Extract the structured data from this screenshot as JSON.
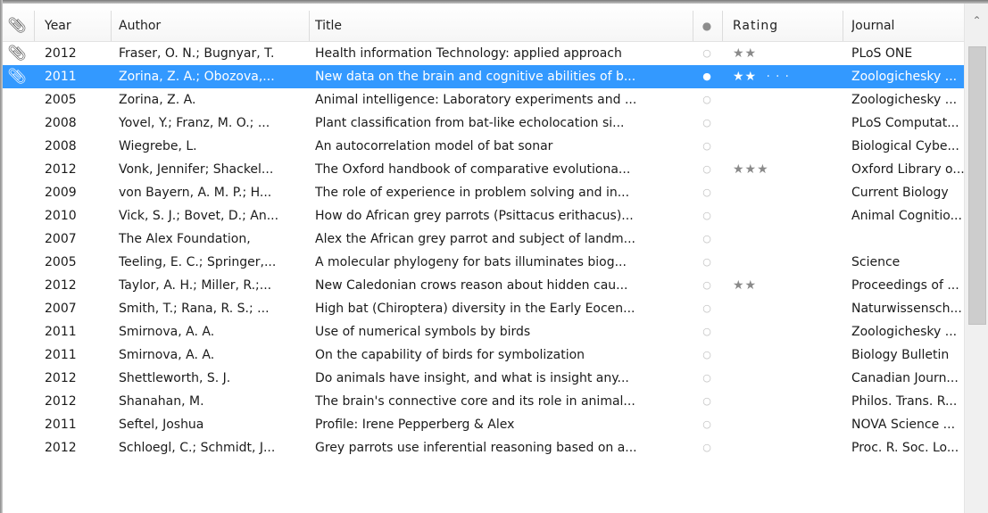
{
  "columns": {
    "attachments_icon": "paperclip-icon",
    "year": "Year",
    "author": "Author",
    "title": "Title",
    "read_icon": "read-status-icon",
    "rating": "Rating",
    "journal": "Journal"
  },
  "colors": {
    "selection": "#3399ff",
    "star": "#8a8a8a"
  },
  "rows": [
    {
      "attachment": true,
      "selected": false,
      "year": "2012",
      "author": "Fraser, O. N.; Bugnyar, T.",
      "title": "Health information Technology: applied approach",
      "read": "○",
      "rating": "★★",
      "journal": "PLoS ONE"
    },
    {
      "attachment": true,
      "selected": true,
      "year": "2011",
      "author": "Zorina, Z. A.; Obozova,...",
      "title": "New data on the brain and cognitive abilities of b...",
      "read": "●",
      "rating": "★★",
      "journal": "Zoologichesky ..."
    },
    {
      "attachment": false,
      "selected": false,
      "year": "2005",
      "author": "Zorina, Z. A.",
      "title": "Animal intelligence: Laboratory experiments and ...",
      "read": "○",
      "rating": "",
      "journal": "Zoologichesky ..."
    },
    {
      "attachment": false,
      "selected": false,
      "year": "2008",
      "author": "Yovel, Y.; Franz, M. O.; ...",
      "title": "Plant classification from bat-like echolocation si...",
      "read": "○",
      "rating": "",
      "journal": "PLoS Computat..."
    },
    {
      "attachment": false,
      "selected": false,
      "year": "2008",
      "author": "Wiegrebe, L.",
      "title": "An autocorrelation model of bat sonar",
      "read": "○",
      "rating": "",
      "journal": "Biological Cybe..."
    },
    {
      "attachment": false,
      "selected": false,
      "year": "2012",
      "author": "Vonk, Jennifer; Shackel...",
      "title": "The Oxford handbook of comparative evolutiona...",
      "read": "○",
      "rating": "★★★",
      "journal": "Oxford Library o..."
    },
    {
      "attachment": false,
      "selected": false,
      "year": "2009",
      "author": "von Bayern, A. M. P.; H...",
      "title": "The role of experience in problem solving and in...",
      "read": "○",
      "rating": "",
      "journal": "Current Biology"
    },
    {
      "attachment": false,
      "selected": false,
      "year": "2010",
      "author": "Vick, S. J.; Bovet, D.; An...",
      "title": "How do African grey parrots (Psittacus erithacus)...",
      "read": "○",
      "rating": "",
      "journal": "Animal Cognitio..."
    },
    {
      "attachment": false,
      "selected": false,
      "year": "2007",
      "author": "The Alex Foundation,",
      "title": "Alex the African grey parrot and subject of landm...",
      "read": "○",
      "rating": "",
      "journal": ""
    },
    {
      "attachment": false,
      "selected": false,
      "year": "2005",
      "author": "Teeling, E. C.; Springer,...",
      "title": "A molecular phylogeny for bats illuminates biog...",
      "read": "○",
      "rating": "",
      "journal": "Science"
    },
    {
      "attachment": false,
      "selected": false,
      "year": "2012",
      "author": "Taylor, A. H.; Miller, R.;...",
      "title": "New Caledonian crows reason about hidden cau...",
      "read": "○",
      "rating": "★★",
      "journal": "Proceedings of ..."
    },
    {
      "attachment": false,
      "selected": false,
      "year": "2007",
      "author": "Smith, T.; Rana, R. S.; ...",
      "title": "High bat (Chiroptera) diversity in the Early Eocen...",
      "read": "○",
      "rating": "",
      "journal": "Naturwissensch..."
    },
    {
      "attachment": false,
      "selected": false,
      "year": "2011",
      "author": "Smirnova, A. A.",
      "title": "Use of numerical symbols by birds",
      "read": "○",
      "rating": "",
      "journal": "Zoologichesky ..."
    },
    {
      "attachment": false,
      "selected": false,
      "year": "2011",
      "author": "Smirnova, A. A.",
      "title": "On the capability of birds for symbolization",
      "read": "○",
      "rating": "",
      "journal": "Biology Bulletin"
    },
    {
      "attachment": false,
      "selected": false,
      "year": "2012",
      "author": "Shettleworth, S. J.",
      "title": "Do animals have insight, and what is insight any...",
      "read": "○",
      "rating": "",
      "journal": "Canadian Journ..."
    },
    {
      "attachment": false,
      "selected": false,
      "year": "2012",
      "author": "Shanahan, M.",
      "title": "The brain's connective core and its role in animal...",
      "read": "○",
      "rating": "",
      "journal": "Philos. Trans. R..."
    },
    {
      "attachment": false,
      "selected": false,
      "year": "2011",
      "author": "Seftel, Joshua",
      "title": "Profile: Irene Pepperberg & Alex",
      "read": "○",
      "rating": "",
      "journal": "NOVA Science ..."
    },
    {
      "attachment": false,
      "selected": false,
      "year": "2012",
      "author": "Schloegl, C.; Schmidt, J...",
      "title": "Grey parrots use inferential reasoning based on a...",
      "read": "○",
      "rating": "",
      "journal": "Proc. R. Soc. Lo..."
    }
  ],
  "scrollbar": {
    "up_arrow_icon": "chevron-up-icon"
  }
}
